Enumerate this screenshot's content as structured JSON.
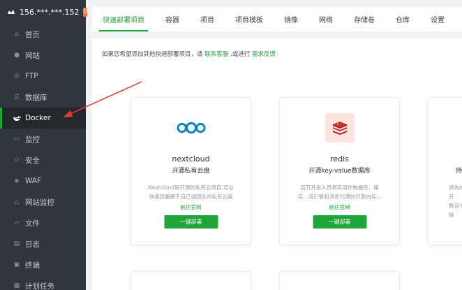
{
  "server": {
    "ip": "156.***.***.152",
    "badge": "0"
  },
  "sidebar": {
    "items": [
      {
        "label": "首页",
        "icon": "home-icon"
      },
      {
        "label": "网站",
        "icon": "globe-icon"
      },
      {
        "label": "FTP",
        "icon": "ftp-icon"
      },
      {
        "label": "数据库",
        "icon": "database-icon"
      },
      {
        "label": "Docker",
        "icon": "docker-icon"
      },
      {
        "label": "监控",
        "icon": "monitor-icon"
      },
      {
        "label": "安全",
        "icon": "shield-icon"
      },
      {
        "label": "WAF",
        "icon": "waf-icon"
      },
      {
        "label": "网站监控",
        "icon": "site-monitor-icon"
      },
      {
        "label": "文件",
        "icon": "folder-icon"
      },
      {
        "label": "日志",
        "icon": "log-icon"
      },
      {
        "label": "终端",
        "icon": "terminal-icon"
      },
      {
        "label": "计划任务",
        "icon": "calendar-icon"
      }
    ],
    "active_index": 4
  },
  "tabs": [
    {
      "label": "快速部署项目"
    },
    {
      "label": "容器"
    },
    {
      "label": "项目"
    },
    {
      "label": "项目模板"
    },
    {
      "label": "镜像"
    },
    {
      "label": "网络"
    },
    {
      "label": "存储卷"
    },
    {
      "label": "仓库"
    },
    {
      "label": "设置"
    }
  ],
  "notice": {
    "prefix": "如果您希望添加其他快速部署项目，请",
    "contact_link": "联系客服",
    "middle": ",或进行",
    "feedback_link": "需求反馈"
  },
  "apps": [
    {
      "name": "nextcloud",
      "subtitle": "开源私有云盘",
      "desc_line1": "Nextcloud是开源的私有云项目,可以",
      "desc_line2": "快速部署属于自己或团队的私有云盘",
      "site_link": "前往官网",
      "deploy_label": "一键部署"
    },
    {
      "name": "redis",
      "subtitle": "开源key-value数据库",
      "desc_line1": "百万开发人员将其用作数据库、缓",
      "desc_line2": "存、流引擎和消息代理的开源内存...",
      "site_link": "前往官网",
      "deploy_label": "一键部署"
    },
    {
      "subtitle_partial": "持",
      "desc_line1_partial": "领先的开",
      "desc_line2_partial": "数百个操"
    }
  ],
  "colors": {
    "accent": "#20a53a",
    "sidebar_bg": "#30363d",
    "badge": "#f0742a",
    "arrow": "#e53935"
  }
}
